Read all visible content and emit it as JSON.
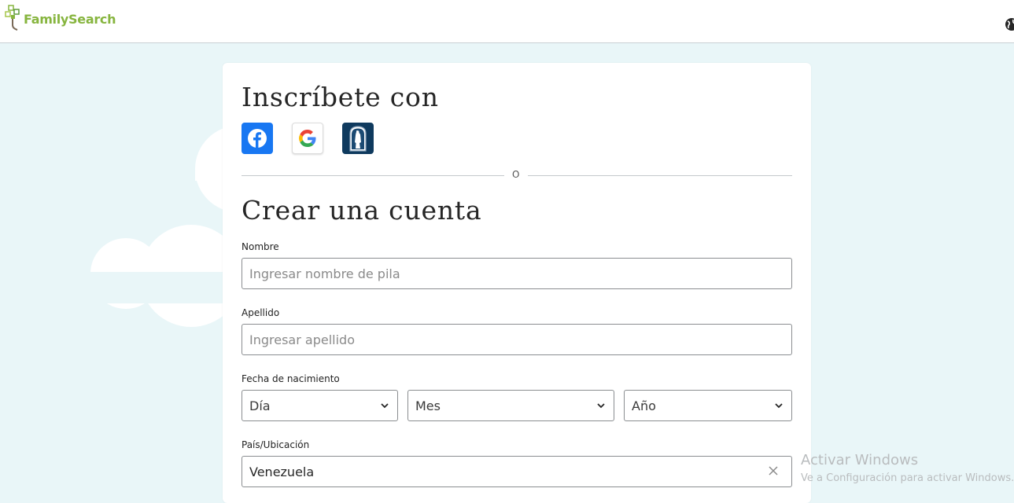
{
  "header": {
    "logo_text": "FamilySearch",
    "logo_icon": "family-tree-icon",
    "language_icon": "globe-icon"
  },
  "card": {
    "signup_with_heading": "Inscríbete con",
    "social": [
      {
        "name": "facebook-icon",
        "color": "#1877f2"
      },
      {
        "name": "google-icon",
        "color": "#ffffff"
      },
      {
        "name": "church-account-icon",
        "color": "#0f3a5e"
      }
    ],
    "divider_text": "O",
    "create_heading": "Crear una cuenta",
    "first_name": {
      "label": "Nombre",
      "placeholder": "Ingresar nombre de pila",
      "value": ""
    },
    "last_name": {
      "label": "Apellido",
      "placeholder": "Ingresar apellido",
      "value": ""
    },
    "birth_date": {
      "label": "Fecha de nacimiento",
      "day": "Día",
      "month": "Mes",
      "year": "Año"
    },
    "country": {
      "label": "País/Ubicación",
      "value": "Venezuela"
    }
  },
  "watermark": {
    "line1": "Activar Windows",
    "line2": "Ve a Configuración para activar Windows."
  },
  "colors": {
    "background": "#e9f6f8",
    "brand_green": "#87b53f"
  }
}
